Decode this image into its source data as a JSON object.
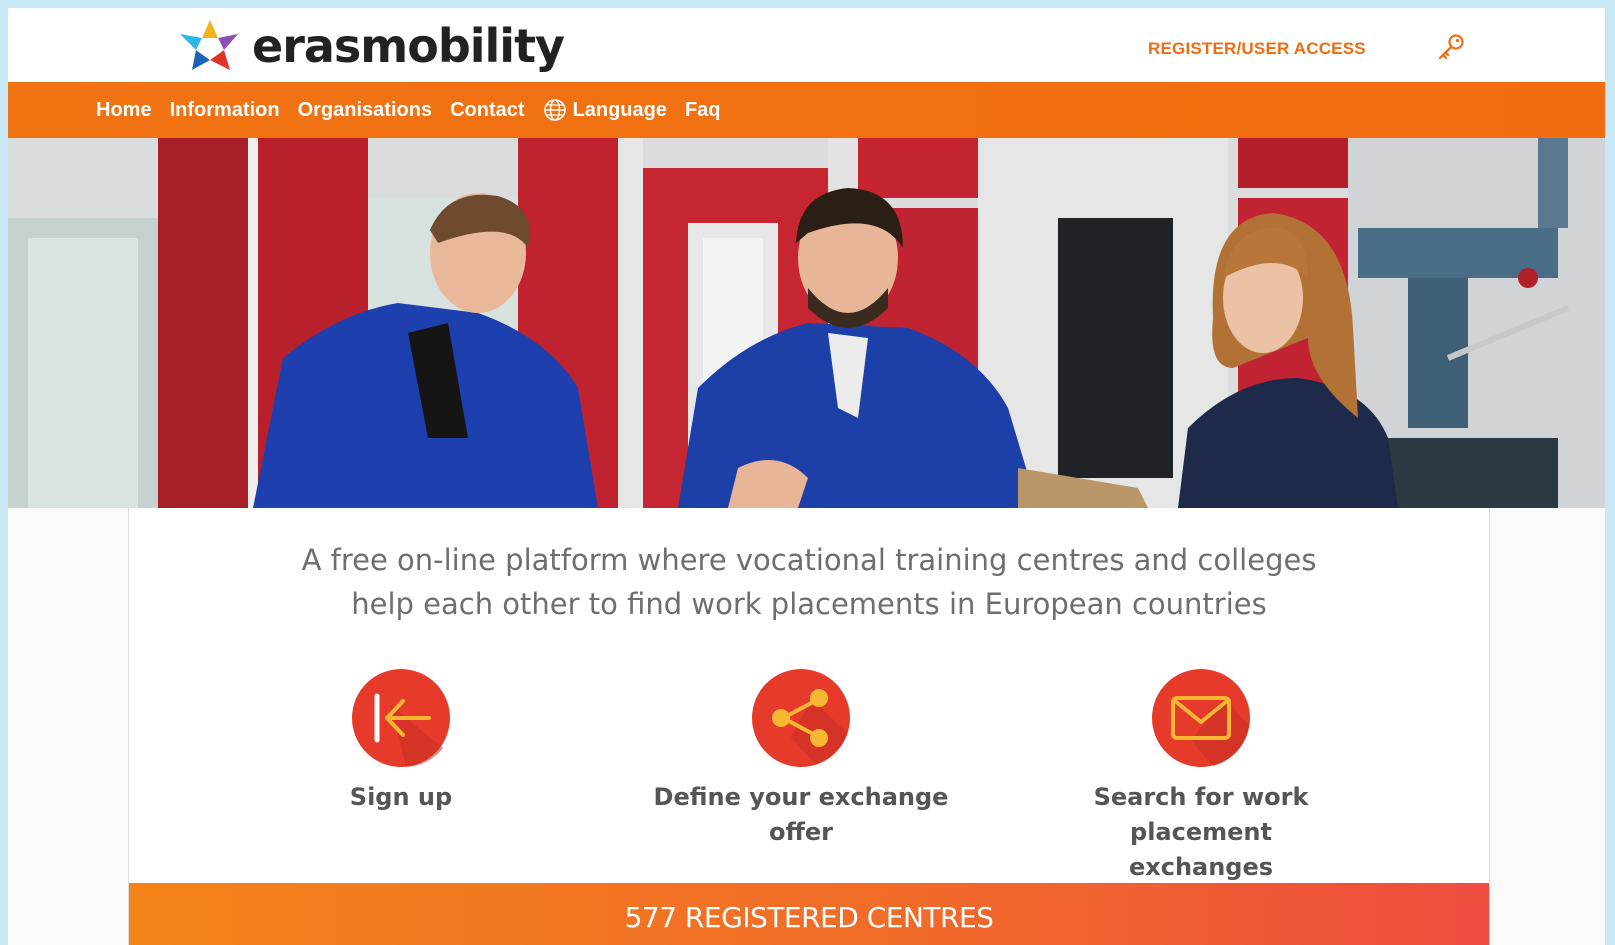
{
  "brand": {
    "name": "erasmobility"
  },
  "header": {
    "register_label": "REGISTER/USER ACCESS",
    "key_icon": "key-icon"
  },
  "nav": {
    "items": [
      {
        "label": "Home"
      },
      {
        "label": "Information"
      },
      {
        "label": "Organisations"
      },
      {
        "label": "Contact"
      },
      {
        "label": "Language",
        "icon": "globe-icon"
      },
      {
        "label": "Faq"
      }
    ]
  },
  "hero": {
    "description": "photo-of-three-students-in-blue-workwear-in-workshop"
  },
  "main": {
    "tagline_line1": "A free on-line platform where vocational training centres and colleges",
    "tagline_line2": "help each other to find work placements in European countries",
    "features": [
      {
        "icon": "sign-in-arrow-icon",
        "label": "Sign up"
      },
      {
        "icon": "share-icon",
        "label": "Define your exchange offer"
      },
      {
        "icon": "envelope-icon",
        "label_line1": "Search for work placement",
        "label_line2": "exchanges"
      }
    ],
    "counter": "577 REGISTERED CENTRES"
  },
  "colors": {
    "accent": "#f07312",
    "icon_circle": "#e53b2c",
    "icon_glyph": "#f7b733",
    "text": "#555555"
  }
}
